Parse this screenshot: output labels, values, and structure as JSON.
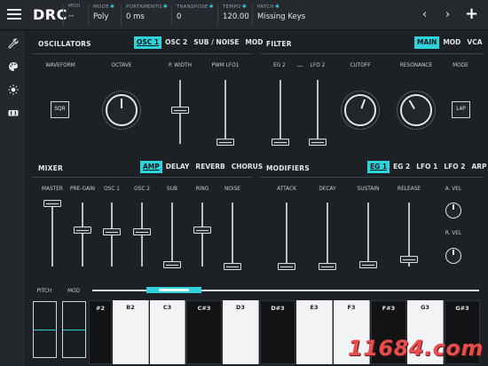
{
  "header": {
    "title": "DRC",
    "fields": [
      {
        "label": "MIDI",
        "value": "--",
        "gear": false
      },
      {
        "label": "MODE",
        "value": "Poly",
        "gear": true
      },
      {
        "label": "PORTAMENTO",
        "value": "0 ms",
        "gear": true
      },
      {
        "label": "TRANSPOSE",
        "value": "0",
        "gear": true
      },
      {
        "label": "TEMPO",
        "value": "120.00",
        "gear": true
      },
      {
        "label": "PATCH",
        "value": "Missing Keys",
        "gear": true
      }
    ],
    "back_glyph": "‹",
    "forward_glyph": "›",
    "add_glyph": "+",
    "gear_glyph": "✱"
  },
  "sidebar": {
    "icons": [
      "wrench-icon",
      "palette-icon",
      "brightness-icon",
      "fx-rack-icon"
    ]
  },
  "oscillators": {
    "title": "OSCILLATORS",
    "tabs": [
      {
        "label": "OSC 1",
        "active": true
      },
      {
        "label": "OSC 2",
        "active": false
      },
      {
        "label": "SUB / NOISE",
        "active": false
      },
      {
        "label": "MOD",
        "active": false
      }
    ],
    "waveform_label": "WAVEFORM",
    "waveform_value": "SQR",
    "octave_label": "OCTAVE",
    "pwidth_label": "P. WIDTH",
    "pwm_label": "PWM LFO1"
  },
  "filter": {
    "title": "FILTER",
    "tabs": [
      {
        "label": "MAIN",
        "active": true
      },
      {
        "label": "MOD",
        "active": false
      },
      {
        "label": "VCA",
        "active": false
      }
    ],
    "eg2_label": "EG 2",
    "dash": "—",
    "lfo2_label": "LFO 2",
    "cutoff_label": "CUTOFF",
    "resonance_label": "RESONANCE",
    "mode_label": "MODE",
    "mode_value": "L4P"
  },
  "mixer": {
    "title": "MIXER",
    "tabs": [
      {
        "label": "AMP",
        "active": true
      },
      {
        "label": "DELAY",
        "active": false
      },
      {
        "label": "REVERB",
        "active": false
      },
      {
        "label": "CHORUS",
        "active": false
      }
    ],
    "channels": [
      "MASTER",
      "PRE-GAIN",
      "OSC 1",
      "OSC 2",
      "SUB",
      "RING",
      "NOISE"
    ]
  },
  "modifiers": {
    "title": "MODIFIERS",
    "tabs": [
      {
        "label": "EG 1",
        "active": true
      },
      {
        "label": "EG 2",
        "active": false
      },
      {
        "label": "LFO 1",
        "active": false
      },
      {
        "label": "LFO 2",
        "active": false
      },
      {
        "label": "ARP",
        "active": false
      }
    ],
    "params": [
      "ATTACK",
      "DECAY",
      "SUSTAIN",
      "RELEASE"
    ],
    "avel_label": "A. VEL",
    "rvel_label": "R. VEL"
  },
  "keyboard": {
    "pitch_label": "PITCH",
    "mod_label": "MOD",
    "keys": [
      {
        "label": "#2",
        "color": "black"
      },
      {
        "label": "B2",
        "color": "white"
      },
      {
        "label": "C3",
        "color": "white"
      },
      {
        "label": "C#3",
        "color": "black"
      },
      {
        "label": "D3",
        "color": "white"
      },
      {
        "label": "D#3",
        "color": "black"
      },
      {
        "label": "E3",
        "color": "white"
      },
      {
        "label": "F3",
        "color": "white"
      },
      {
        "label": "F#3",
        "color": "black"
      },
      {
        "label": "G3",
        "color": "white"
      },
      {
        "label": "G#3",
        "color": "black"
      }
    ]
  },
  "watermark": "11684.com",
  "colors": {
    "accent": "#2fd3dc",
    "background": "#1d2125",
    "panel_header": "#25292e"
  }
}
